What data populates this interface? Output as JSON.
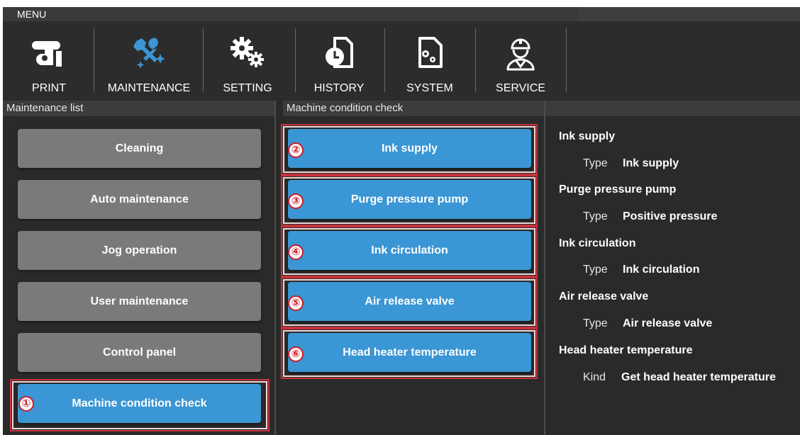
{
  "menu": {
    "title": "MENU"
  },
  "toolbar": [
    {
      "label": "PRINT",
      "icon": "print-icon"
    },
    {
      "label": "MAINTENANCE",
      "icon": "maintenance-icon"
    },
    {
      "label": "SETTING",
      "icon": "gears-icon"
    },
    {
      "label": "HISTORY",
      "icon": "history-icon"
    },
    {
      "label": "SYSTEM",
      "icon": "system-icon"
    },
    {
      "label": "SERVICE",
      "icon": "service-icon"
    }
  ],
  "maintenance_list": {
    "header": "Maintenance list",
    "items": [
      "Cleaning",
      "Auto maintenance",
      "Jog operation",
      "User maintenance",
      "Control panel",
      "Machine condition check"
    ],
    "callout": "①"
  },
  "condition_check": {
    "header": "Machine condition check",
    "items": [
      {
        "label": "Ink supply",
        "callout": "②"
      },
      {
        "label": "Purge pressure pump",
        "callout": "③"
      },
      {
        "label": "Ink circulation",
        "callout": "④"
      },
      {
        "label": "Air release valve",
        "callout": "⑤"
      },
      {
        "label": "Head heater temperature",
        "callout": "⑥"
      }
    ]
  },
  "details": [
    {
      "title": "Ink supply",
      "key": "Type",
      "value": "Ink supply"
    },
    {
      "title": "Purge pressure pump",
      "key": "Type",
      "value": "Positive pressure"
    },
    {
      "title": "Ink circulation",
      "key": "Type",
      "value": "Ink circulation"
    },
    {
      "title": "Air release valve",
      "key": "Type",
      "value": "Air release valve"
    },
    {
      "title": "Head heater temperature",
      "key": "Kind",
      "value": "Get head heater temperature"
    }
  ],
  "colors": {
    "accent": "#3a96d4",
    "callout": "#c81e2a",
    "button_gray": "#7a7a7a"
  }
}
